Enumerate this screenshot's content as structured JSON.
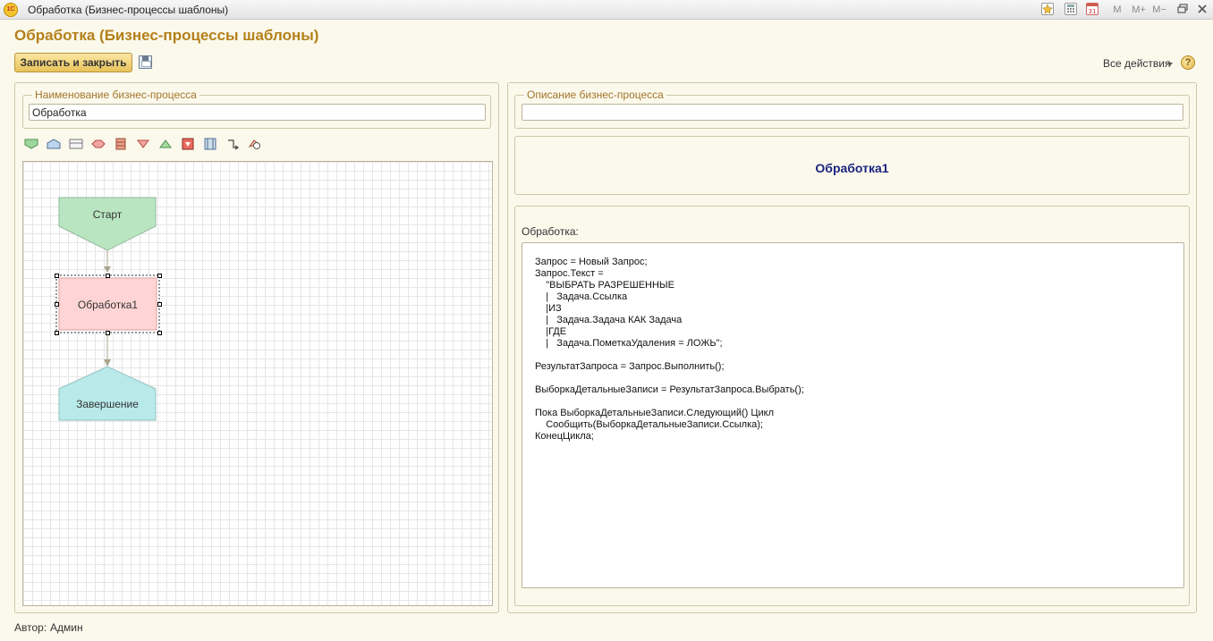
{
  "window": {
    "title": "Обработка (Бизнес-процессы шаблоны)",
    "buttons": {
      "m": "M",
      "m_plus": "M+",
      "m_minus": "M−"
    }
  },
  "form": {
    "title": "Обработка (Бизнес-процессы шаблоны)",
    "save_close_label": "Записать и закрыть",
    "all_actions_label": "Все действия",
    "help_label": "?"
  },
  "left": {
    "name_legend": "Наименование бизнес-процесса",
    "name_value": "Обработка",
    "tools": [
      {
        "name": "start-point-icon",
        "color": "#7fc97f"
      },
      {
        "name": "route-point-icon",
        "color": "#8fb3d9"
      },
      {
        "name": "action-point-icon",
        "color": "#9b9b9b"
      },
      {
        "name": "condition-point-icon",
        "color": "#e8817a"
      },
      {
        "name": "selection-point-icon",
        "color": "#c4684e"
      },
      {
        "name": "split-point-icon",
        "color": "#e8817a"
      },
      {
        "name": "merge-point-icon",
        "color": "#86c27d"
      },
      {
        "name": "end-point-icon",
        "color": "#d9473c"
      },
      {
        "name": "processing-point-icon",
        "color": "#6b8fb5"
      },
      {
        "name": "connector-icon",
        "color": "#555555"
      },
      {
        "name": "decoration-icon",
        "color": "#b55b4e"
      }
    ],
    "diagram": {
      "start": "Старт",
      "processing": "Обработка1",
      "end": "Завершение",
      "colors": {
        "start": "#b9e6c1",
        "processing": "#ffd4d4",
        "end": "#b9eaea",
        "connector": "#a9a58f"
      }
    }
  },
  "right": {
    "description_legend": "Описание бизнес-процесса",
    "description_value": "",
    "block_title": "Обработка1",
    "code_label": "Обработка:",
    "code_lines": [
      "Запрос = Новый Запрос;",
      "Запрос.Текст =",
      "    \"ВЫБРАТЬ РАЗРЕШЕННЫЕ",
      "    |   Задача.Ссылка",
      "    |ИЗ",
      "    |   Задача.Задача КАК Задача",
      "    |ГДЕ",
      "    |   Задача.ПометкаУдаления = ЛОЖЬ\";",
      "",
      "РезультатЗапроса = Запрос.Выполнить();",
      "",
      "ВыборкаДетальныеЗаписи = РезультатЗапроса.Выбрать();",
      "",
      "Пока ВыборкаДетальныеЗаписи.Следующий() Цикл",
      "    Сообщить(ВыборкаДетальныеЗаписи.Ссылка);",
      "КонецЦикла;"
    ]
  },
  "footer": {
    "author_label": "Автор:",
    "author_value": "Админ"
  }
}
